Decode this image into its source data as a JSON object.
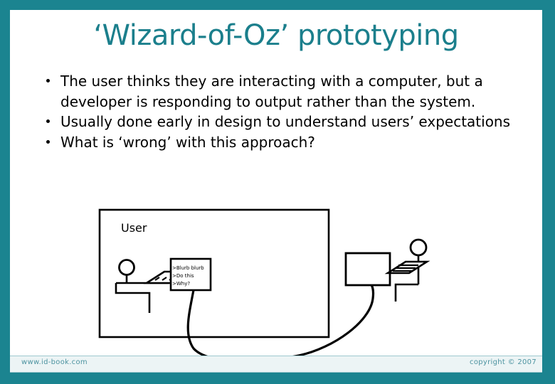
{
  "slide": {
    "title": "‘Wizard-of-Oz’ prototyping",
    "bullets": [
      "The user thinks they are interacting with a computer, but a developer is responding to output rather than the system.",
      "Usually done early in design to understand users’ expectations",
      "What is ‘wrong’ with this approach?"
    ]
  },
  "diagram": {
    "room_label": "User",
    "screen_lines": [
      ">Blurb blurb",
      ">Do this",
      ">Why?"
    ]
  },
  "footer": {
    "left": "www.id-book.com",
    "right": "copyright © 2007"
  },
  "colors": {
    "teal_border": "#1b8490",
    "title_teal": "#1b7f8c",
    "footer_text": "#4c93a0",
    "footer_bar": "#ecf4f5",
    "body_text": "#000000",
    "slide_background": "#ffffff"
  }
}
